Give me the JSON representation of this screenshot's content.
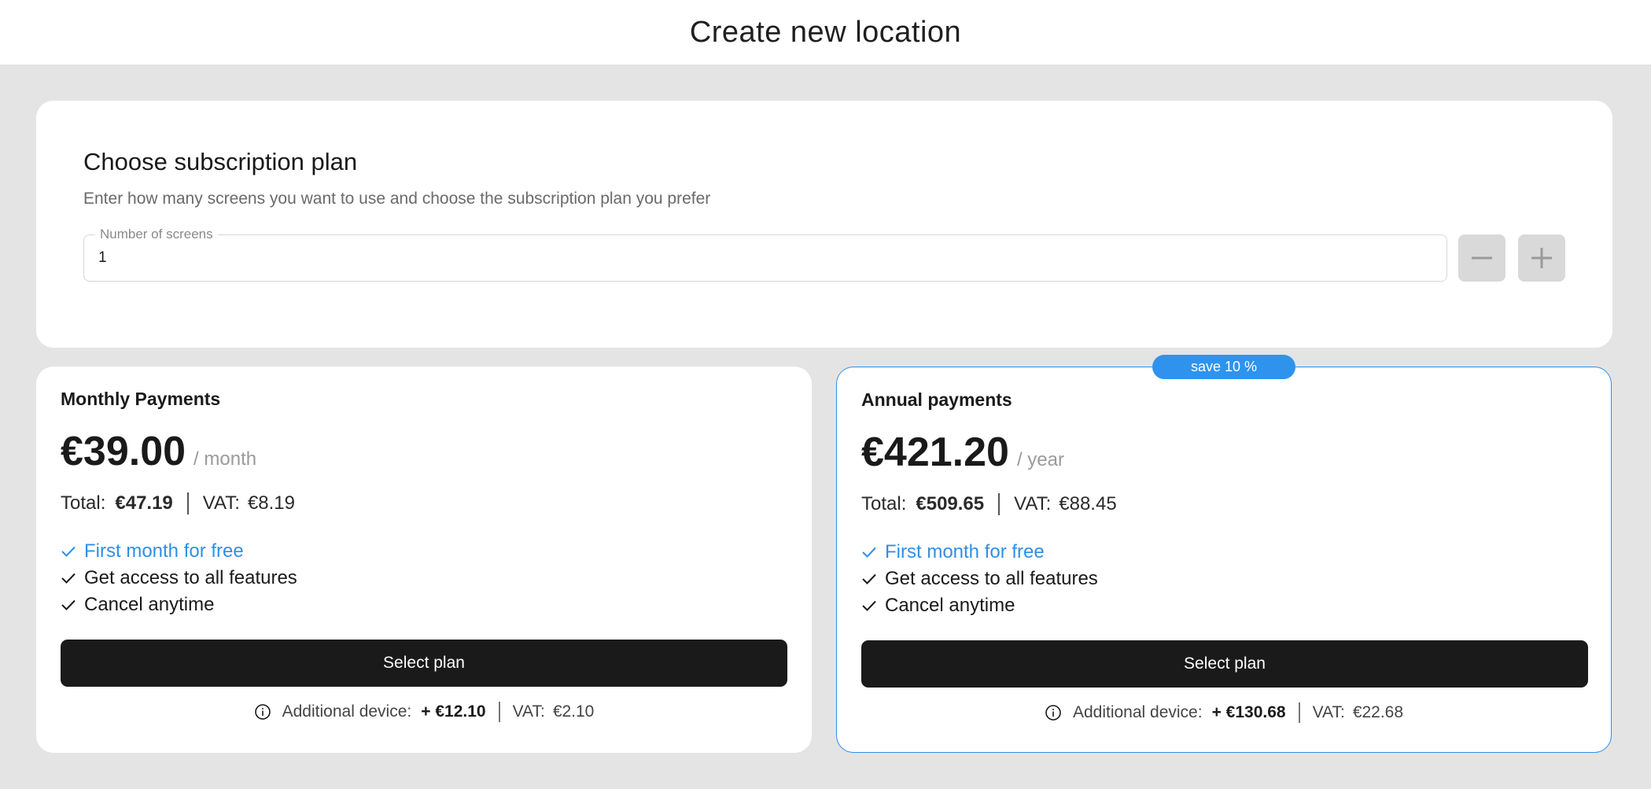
{
  "page": {
    "title": "Create new location"
  },
  "subscription": {
    "heading": "Choose subscription plan",
    "subtitle": "Enter how many screens you want to use and choose the subscription plan you prefer",
    "screens_field": {
      "label": "Number of screens",
      "value": "1"
    },
    "stepper": {
      "minus_icon": "minus-icon",
      "plus_icon": "plus-icon"
    }
  },
  "plans": {
    "monthly": {
      "name": "Monthly Payments",
      "price": "€39.00",
      "period": "/ month",
      "total_label": "Total:",
      "total_value": "€47.19",
      "vat_label": "VAT:",
      "vat_value": "€8.19",
      "features": [
        "First month for free",
        "Get access to all features",
        "Cancel anytime"
      ],
      "button_label": "Select plan",
      "additional_label": "Additional device:",
      "additional_value": "+ €12.10",
      "additional_vat_label": "VAT:",
      "additional_vat_value": "€2.10"
    },
    "annual": {
      "badge": "save 10 %",
      "name": "Annual payments",
      "price": "€421.20",
      "period": "/ year",
      "total_label": "Total:",
      "total_value": "€509.65",
      "vat_label": "VAT:",
      "vat_value": "€88.45",
      "features": [
        "First month for free",
        "Get access to all features",
        "Cancel anytime"
      ],
      "button_label": "Select plan",
      "additional_label": "Additional device:",
      "additional_value": "+ €130.68",
      "additional_vat_label": "VAT:",
      "additional_vat_value": "€22.68"
    }
  },
  "colors": {
    "accent": "#2f8fe8",
    "background": "#e4e4e4",
    "button": "#1a1a1a"
  }
}
